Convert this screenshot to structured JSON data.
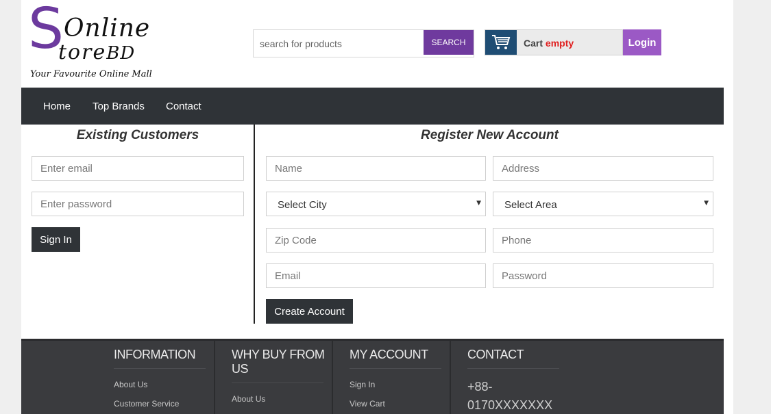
{
  "header": {
    "logo": {
      "big_letter": "S",
      "word_online": "Online",
      "word_store": "tore",
      "word_bd": "BD",
      "tagline": "Your Favourite Online Mall"
    },
    "search": {
      "placeholder": "search for products",
      "button_label": "SEARCH"
    },
    "cart": {
      "label": "Cart",
      "status": "empty"
    },
    "login_label": "Login"
  },
  "nav": {
    "items": [
      {
        "label": "Home"
      },
      {
        "label": "Top Brands"
      },
      {
        "label": "Contact"
      }
    ]
  },
  "existing": {
    "title": "Existing Customers",
    "email_placeholder": "Enter email",
    "password_placeholder": "Enter password",
    "signin_label": "Sign In"
  },
  "register": {
    "title": "Register New Account",
    "name_placeholder": "Name",
    "address_placeholder": "Address",
    "city_selected": "Select City",
    "area_selected": "Select Area",
    "zip_placeholder": "Zip Code",
    "phone_placeholder": "Phone",
    "email_placeholder": "Email",
    "password_placeholder": "Password",
    "create_label": "Create Account"
  },
  "footer": {
    "information": {
      "title": "INFORMATION",
      "links": [
        "About Us",
        "Customer Service"
      ]
    },
    "why": {
      "title_line1": "WHY BUY FROM",
      "title_line2": "US",
      "links": [
        "About Us"
      ]
    },
    "account": {
      "title": "MY ACCOUNT",
      "links": [
        "Sign In",
        "View Cart"
      ]
    },
    "contact": {
      "title": "CONTACT",
      "phone_line1": "+88-",
      "phone_line2": "0170XXXXXXX"
    }
  },
  "colors": {
    "brand_purple": "#6f3a9e",
    "login_purple": "#9b59c5",
    "nav_dark": "#2f3337",
    "cart_blue": "#1f4d74",
    "cart_empty_red": "#e02020"
  }
}
